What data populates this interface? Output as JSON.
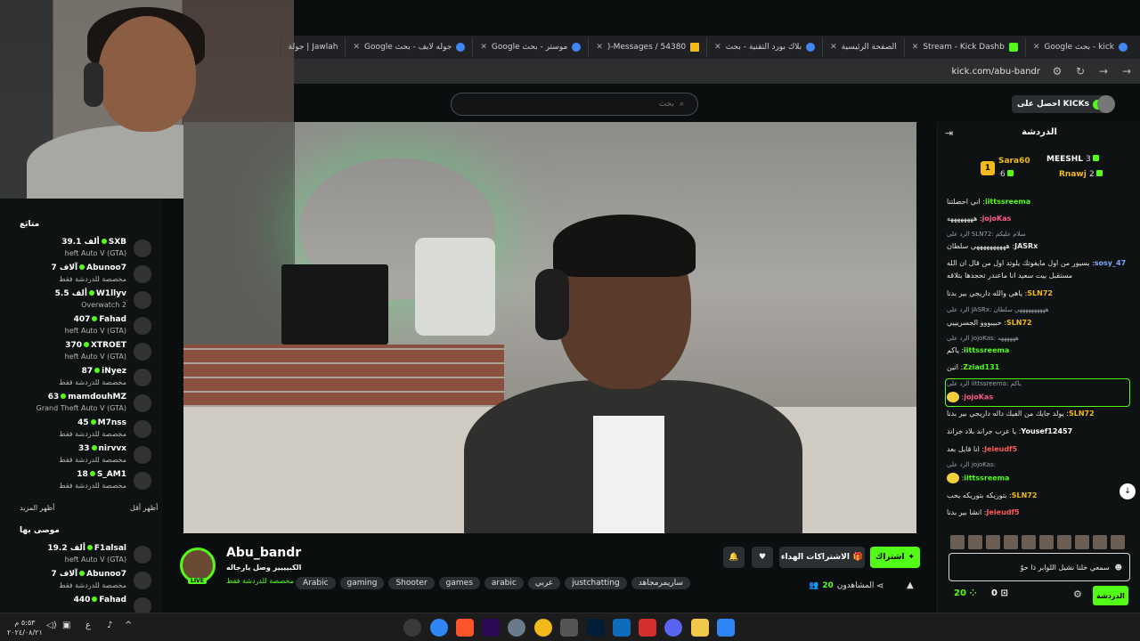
{
  "browser": {
    "tabs": [
      {
        "label": "kick - بحث Google",
        "icon": "google-icon"
      },
      {
        "label": "Stream - Kick Dashb",
        "icon": "kick-icon"
      },
      {
        "label": "الصفحة الرئيسية",
        "icon": "generic-icon"
      },
      {
        "label": "بلاك بورد التقنية - بحث",
        "icon": "google-icon"
      },
      {
        "label": "Messages / 54380-(",
        "icon": "chart-icon"
      },
      {
        "label": "موستر - بحث Google",
        "icon": "google-icon"
      },
      {
        "label": "جوله لايف - بحث Google",
        "icon": "google-icon"
      },
      {
        "label": "Jawlah | جولة",
        "icon": "jawlah-icon"
      }
    ],
    "address": "kick.com/abu-bandr"
  },
  "header": {
    "search_placeholder": "بحث",
    "get_kicks_label": "احصل على KICKs"
  },
  "sidebar": {
    "following_title": "متابَع",
    "show_more": "أظهر المزيد",
    "show_less": "أظهر أقل",
    "recommended_title": "موصى بها",
    "items": [
      {
        "name": "SXB",
        "viewers": "39.1 ألف",
        "sub": "heft Auto V (GTA)"
      },
      {
        "name": "Abunoo7",
        "viewers": "7 آلاف",
        "sub": "مخصصة للدردشة فقط"
      },
      {
        "name": "W1llyv",
        "viewers": "5.5 ألف",
        "sub": "Overwatch 2"
      },
      {
        "name": "Fahad",
        "viewers": "407",
        "sub": "heft Auto V (GTA)"
      },
      {
        "name": "XTROET",
        "viewers": "370",
        "sub": "heft Auto V (GTA)"
      },
      {
        "name": "iNyez",
        "viewers": "87",
        "sub": "مخصصة للدردشة فقط"
      },
      {
        "name": "mamdouhMZ",
        "viewers": "63",
        "sub": "Grand Theft Auto V (GTA)"
      },
      {
        "name": "M7nss",
        "viewers": "45",
        "sub": "مخصصة للدردشة فقط"
      },
      {
        "name": "nirvvx",
        "viewers": "33",
        "sub": "مخصصة للدردشة فقط"
      },
      {
        "name": "S_AM1",
        "viewers": "18",
        "sub": "مخصصة للدردشة فقط"
      }
    ],
    "recommended": [
      {
        "name": "F1alsal",
        "viewers": "19.2 ألف",
        "sub": "heft Auto V (GTA)"
      },
      {
        "name": "Abunoo7",
        "viewers": "7 آلاف",
        "sub": "مخصصة للدردشة فقط"
      },
      {
        "name": "Fahad",
        "viewers": "440",
        "sub": ""
      }
    ]
  },
  "stream": {
    "streamer": "Abu_bandr",
    "title": "الكبيييير وصل يارجاله",
    "category": "مخصصة للدردشة فقط",
    "live": "LIVE",
    "tags": [
      "Arabic",
      "gaming",
      "Shooter",
      "games",
      "arabic",
      "عربي",
      "justchatting",
      "ساريمرمجاهد"
    ],
    "subscribe": "اشتراك",
    "gift_subs": "الاشتراكات الهداء",
    "viewers_label": "المشاهدون",
    "viewers_count": "20"
  },
  "chat": {
    "title": "الدردشة",
    "gifters": [
      {
        "name": "MEESHL",
        "count": "3",
        "color": "#ffffff"
      },
      {
        "name": "Sara60",
        "count": "6",
        "color": "#f2b91a"
      },
      {
        "name": "Rnawj",
        "count": "2",
        "color": "#f2b91a"
      }
    ],
    "rank": "1",
    "messages": [
      {
        "user": "iittssreema",
        "text": "اني احضلتنا",
        "color": "#53fc18"
      },
      {
        "user": "jojoKas",
        "text": "ههههههههه",
        "color": "#ff5c8a"
      },
      {
        "reply": "الرد على SLN72: سلام عليكم"
      },
      {
        "user": "JASRx",
        "text": "ههههههههههي سلطان",
        "color": "#e6e6e6"
      },
      {
        "user": "sosy_47",
        "text": "بسيور من اول مايفوتك يلوتد اول من قال ان الله",
        "color": "#7aa8ff"
      },
      {
        "text": "مستقبل بيت سعيد انا ماعندر تحجدها بتلاقه"
      },
      {
        "user": "SLN72",
        "text": "ياهي والله داريجي بير بدنا",
        "color": "#f2b91a"
      },
      {
        "reply": "الرد على JASRx: ههههههههههي سلطان"
      },
      {
        "user": "SLN72",
        "text": "حبيبووو الجسريييي",
        "color": "#f2b91a"
      },
      {
        "reply": "الرد على jojoKas: ههههههه"
      },
      {
        "user": "iittssreema",
        "text": "ياكم",
        "color": "#53fc18"
      },
      {
        "user": "Zziad131",
        "text": "اتين",
        "color": "#53fc18"
      },
      {
        "reply": "الرد على iittssreema: ياكم"
      },
      {
        "user": "jojoKas",
        "text": "",
        "color": "#ff5c8a"
      },
      {
        "user": "SLN72",
        "text": "يولد جايك من الفيك داله داريجي بير بدنا",
        "color": "#f2b91a"
      },
      {
        "user": "Yousef12457",
        "text": "يا عرب جراند بلاد جراند",
        "color": "#ffffff"
      },
      {
        "user": "Jeieudf5",
        "text": "انا قايل بعد",
        "color": "#ff5c5c"
      },
      {
        "reply": "الرد على jojoKas:"
      },
      {
        "user": "iittssreema",
        "text": "",
        "color": "#53fc18"
      },
      {
        "user": "SLN72",
        "text": "بتوريكه بتوريكه يحب",
        "color": "#f2b91a"
      },
      {
        "user": "Jeieudf5",
        "text": "انشا بير بدنا",
        "color": "#ff5c5c"
      }
    ],
    "input_text": "سمعي خلنا نشيل اللوابر ذا حوّ",
    "send": "الدردشة",
    "kicks_balance": "0",
    "points_balance": "20"
  },
  "taskbar": {
    "time": "٥:٥٣ م",
    "date": "٢٠٢٤/٠٨/٢١",
    "lang": "ع"
  }
}
